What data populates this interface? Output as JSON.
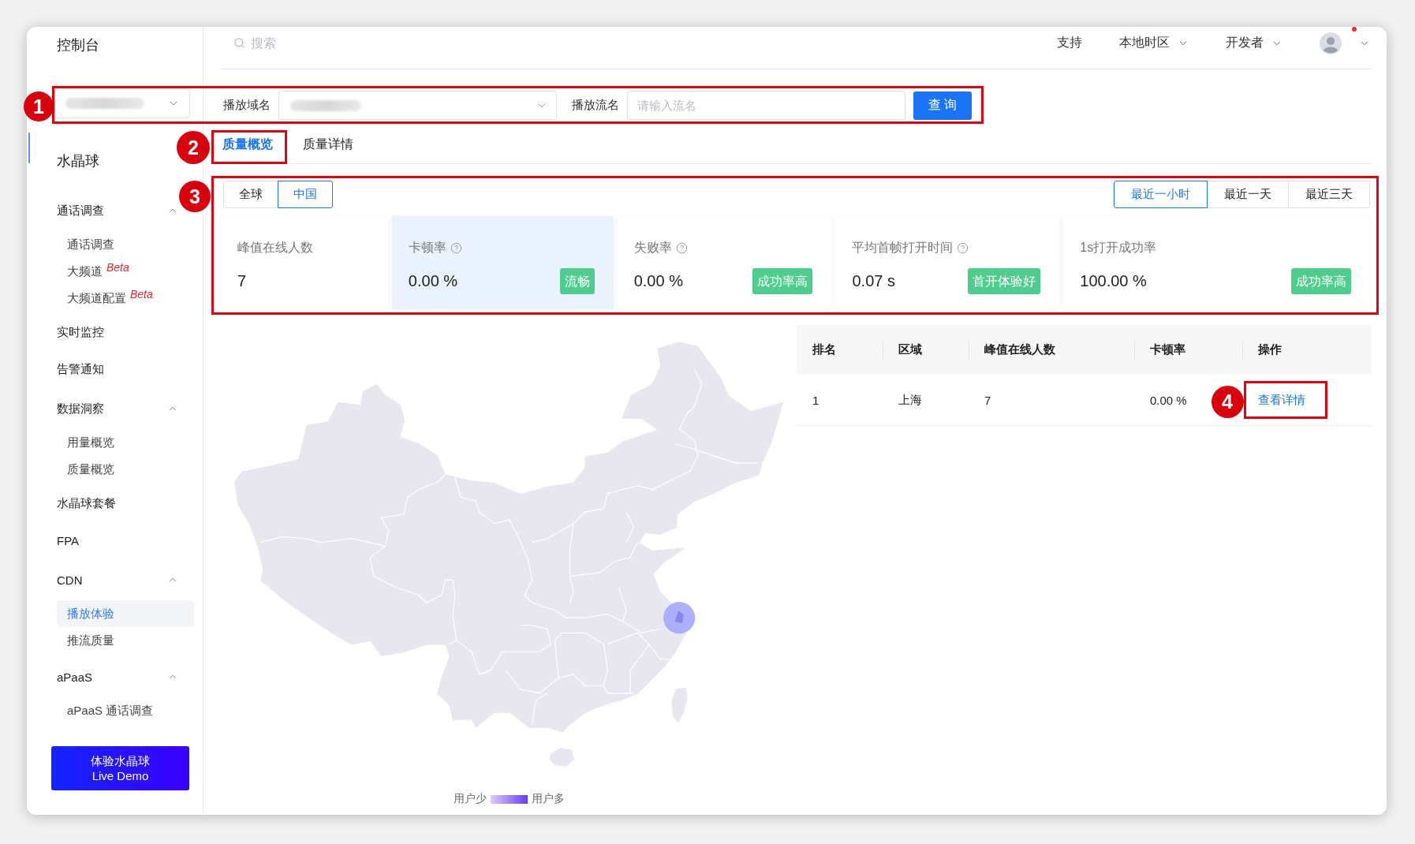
{
  "sidebar": {
    "title": "控制台",
    "app_select": {
      "value_redacted": true
    },
    "product": "水晶球",
    "items": [
      {
        "kind": "group",
        "label": "通话调查",
        "expanded": true,
        "children": [
          {
            "label": "通话调查",
            "selected": false
          },
          {
            "label": "大频道",
            "tag": "Beta",
            "selected": false
          },
          {
            "label": "大频道配置",
            "tag": "Beta",
            "selected": false
          }
        ]
      },
      {
        "kind": "link",
        "label": "实时监控",
        "selected": false
      },
      {
        "kind": "link",
        "label": "告警通知",
        "selected": false
      },
      {
        "kind": "group",
        "label": "数据洞察",
        "expanded": true,
        "children": [
          {
            "label": "用量概览",
            "selected": false
          },
          {
            "label": "质量概览",
            "selected": false
          }
        ]
      },
      {
        "kind": "link",
        "label": "水晶球套餐",
        "selected": false
      },
      {
        "kind": "link",
        "label": "FPA",
        "selected": false
      },
      {
        "kind": "group",
        "label": "CDN",
        "expanded": true,
        "children": [
          {
            "label": "播放体验",
            "selected": true
          },
          {
            "label": "推流质量",
            "selected": false
          }
        ]
      },
      {
        "kind": "group",
        "label": "aPaaS",
        "expanded": true,
        "children": [
          {
            "label": "aPaaS 通话调查",
            "selected": false
          }
        ]
      }
    ],
    "demo_button": {
      "lines": [
        "体验水晶球",
        "Live Demo"
      ]
    }
  },
  "header": {
    "search": {
      "placeholder": "搜索"
    },
    "nav": [
      {
        "label": "支持",
        "dropdown": false
      },
      {
        "label": "本地时区",
        "dropdown": true
      },
      {
        "label": "开发者",
        "dropdown": true
      }
    ],
    "user": {
      "notification": true,
      "dropdown": true
    }
  },
  "filters": {
    "domain": {
      "label": "播放域名",
      "value_redacted": true
    },
    "stream": {
      "label": "播放流名",
      "placeholder": "请输入流名"
    },
    "query_button": "查 询"
  },
  "tabs": [
    {
      "label": "质量概览",
      "selected": true
    },
    {
      "label": "质量详情",
      "selected": false
    }
  ],
  "region_toggle": [
    {
      "label": "全球",
      "selected": false
    },
    {
      "label": "中国",
      "selected": true
    }
  ],
  "time_range": [
    {
      "label": "最近一小时",
      "selected": true
    },
    {
      "label": "最近一天",
      "selected": false
    },
    {
      "label": "最近三天",
      "selected": false
    }
  ],
  "metrics": [
    {
      "label": "峰值在线人数",
      "help": false,
      "value": "7",
      "selected": false
    },
    {
      "label": "卡顿率",
      "help": true,
      "value": "0.00 %",
      "badge": "流畅",
      "selected": true
    },
    {
      "label": "失败率",
      "help": true,
      "value": "0.00 %",
      "badge": "成功率高",
      "selected": false
    },
    {
      "label": "平均首帧打开时间",
      "help": true,
      "value": "0.07 s",
      "badge": "首开体验好",
      "selected": false
    },
    {
      "label": "1s打开成功率",
      "help": false,
      "value": "100.00 %",
      "badge": "成功率高",
      "selected": false
    }
  ],
  "map": {
    "legend_low": "用户少",
    "legend_high": "用户多"
  },
  "table": {
    "columns": [
      "排名",
      "区域",
      "峰值在线人数",
      "卡顿率",
      "操作"
    ],
    "rows": [
      {
        "cells": [
          "1",
          "上海",
          "7",
          "0.00 %"
        ],
        "action": "查看详情"
      }
    ]
  },
  "annotations": [
    {
      "number": "1"
    },
    {
      "number": "2"
    },
    {
      "number": "3"
    },
    {
      "number": "4"
    }
  ]
}
